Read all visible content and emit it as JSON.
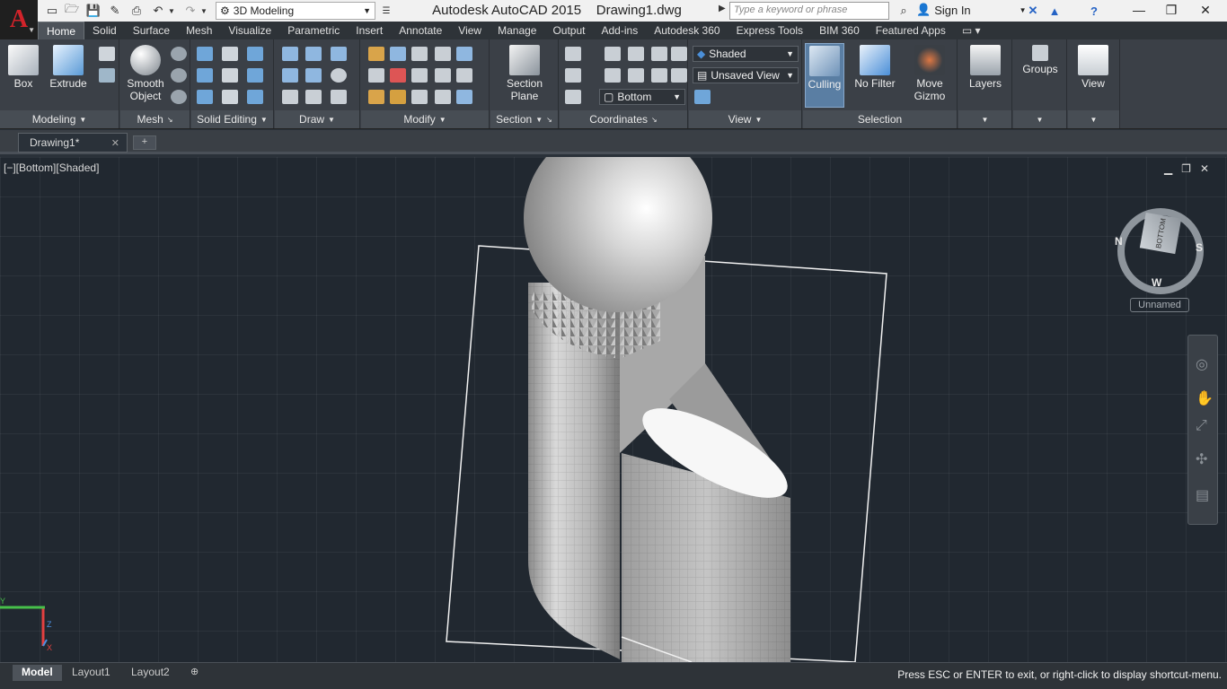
{
  "app": {
    "title": "Autodesk AutoCAD 2015    Drawing1.dwg",
    "logo_letter": "A",
    "workspace": "3D Modeling",
    "search_placeholder": "Type a keyword or phrase",
    "sign_in": "Sign In",
    "help": "?"
  },
  "ribbon_tabs": [
    "Home",
    "Solid",
    "Surface",
    "Mesh",
    "Visualize",
    "Parametric",
    "Insert",
    "Annotate",
    "View",
    "Manage",
    "Output",
    "Add-ins",
    "Autodesk 360",
    "Express Tools",
    "BIM 360",
    "Featured Apps"
  ],
  "ribbon": {
    "modeling": {
      "title": "Modeling",
      "box": "Box",
      "extrude": "Extrude"
    },
    "mesh": {
      "title": "Mesh",
      "smooth_object": "Smooth Object"
    },
    "solid_editing": {
      "title": "Solid Editing"
    },
    "draw": {
      "title": "Draw"
    },
    "modify": {
      "title": "Modify"
    },
    "section": {
      "title": "Section",
      "section_plane": "Section Plane"
    },
    "coordinates": {
      "title": "Coordinates",
      "ucs_view": "Bottom"
    },
    "view": {
      "title": "View",
      "visual_style": "Shaded",
      "saved_view": "Unsaved View"
    },
    "selection": {
      "title": "Selection",
      "culling": "Culling",
      "no_filter": "No Filter",
      "move_gizmo": "Move Gizmo"
    },
    "layers": "Layers",
    "groups": "Groups",
    "view_panel": "View"
  },
  "doc_tabs": {
    "active": "Drawing1*"
  },
  "viewport": {
    "label": "[−][Bottom][Shaded]",
    "viewcube_face": "BOTTOM",
    "compass": [
      "N",
      "S",
      "W"
    ],
    "ucs_name": "Unnamed"
  },
  "layout_tabs": [
    "Model",
    "Layout1",
    "Layout2"
  ],
  "status_message": "Press ESC or ENTER to exit, or right-click to display shortcut-menu.",
  "colors": {
    "accent": "#d2232a",
    "viewport_bg": "#212830",
    "ribbon_bg": "#3b4047"
  }
}
